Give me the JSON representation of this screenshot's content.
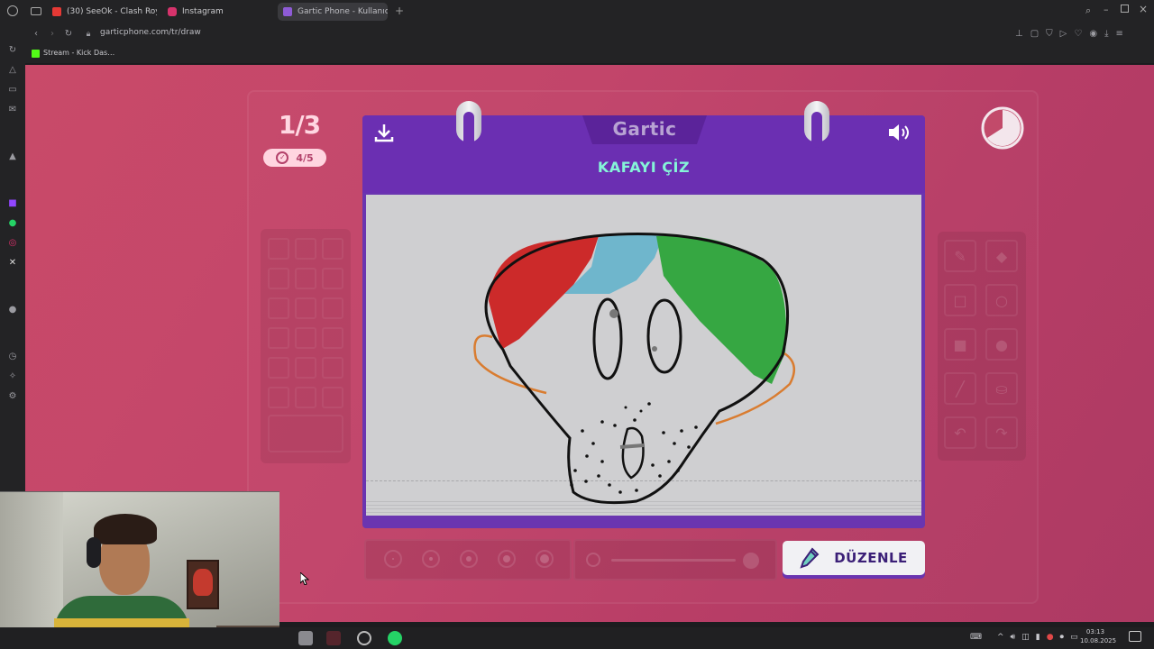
{
  "browser": {
    "tabs": [
      {
        "label": "(30) SeeOk - Clash Roya…",
        "icon": "youtube-icon",
        "color": "#e53935"
      },
      {
        "label": "Instagram",
        "icon": "instagram-icon",
        "color": "#d6336c"
      },
      {
        "label": "Gartic Phone - Kullanıcı P…",
        "icon": "gartic-icon",
        "color": "#8e5bd6"
      }
    ],
    "url": "garticphone.com/tr/draw",
    "bookmark": "Stream - Kick Das…"
  },
  "game": {
    "round": "1/3",
    "players_done": "4/5",
    "logo": "Gartic",
    "prompt": "KAFAYI ÇİZ",
    "edit_button": "DÜZENLE",
    "accent_color": "#6b2fb2",
    "prompt_color": "#85f4d8"
  },
  "taskbar": {
    "time": "03:13",
    "date": "10.08.2025"
  }
}
